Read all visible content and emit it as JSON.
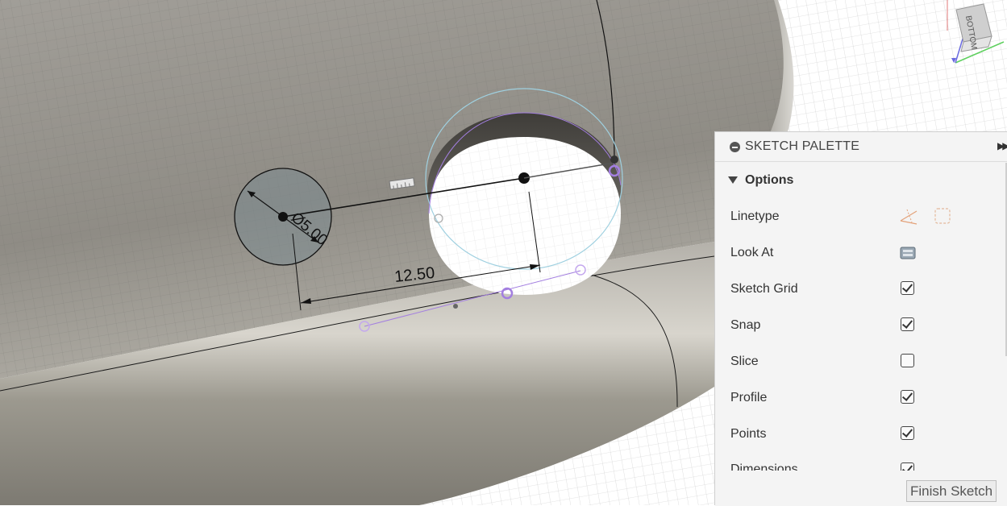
{
  "viewport": {
    "dimension_diameter": "Ø5.00",
    "dimension_distance": "12.50"
  },
  "viewcube": {
    "face_label": "BOTTOM"
  },
  "palette": {
    "title": "SKETCH PALETTE",
    "section_title": "Options",
    "rows": [
      {
        "label": "Linetype",
        "control": "linetype-icons"
      },
      {
        "label": "Look At",
        "control": "look-at-icon"
      },
      {
        "label": "Sketch Grid",
        "checked": true
      },
      {
        "label": "Snap",
        "checked": true
      },
      {
        "label": "Slice",
        "checked": false
      },
      {
        "label": "Profile",
        "checked": true
      },
      {
        "label": "Points",
        "checked": true
      },
      {
        "label": "Dimensions",
        "checked": true
      }
    ],
    "finish_button": "Finish Sketch"
  },
  "colors": {
    "accent_purple": "#a37fe0",
    "construction_blue": "#9fd0e0",
    "surface": "#8f8c86"
  }
}
